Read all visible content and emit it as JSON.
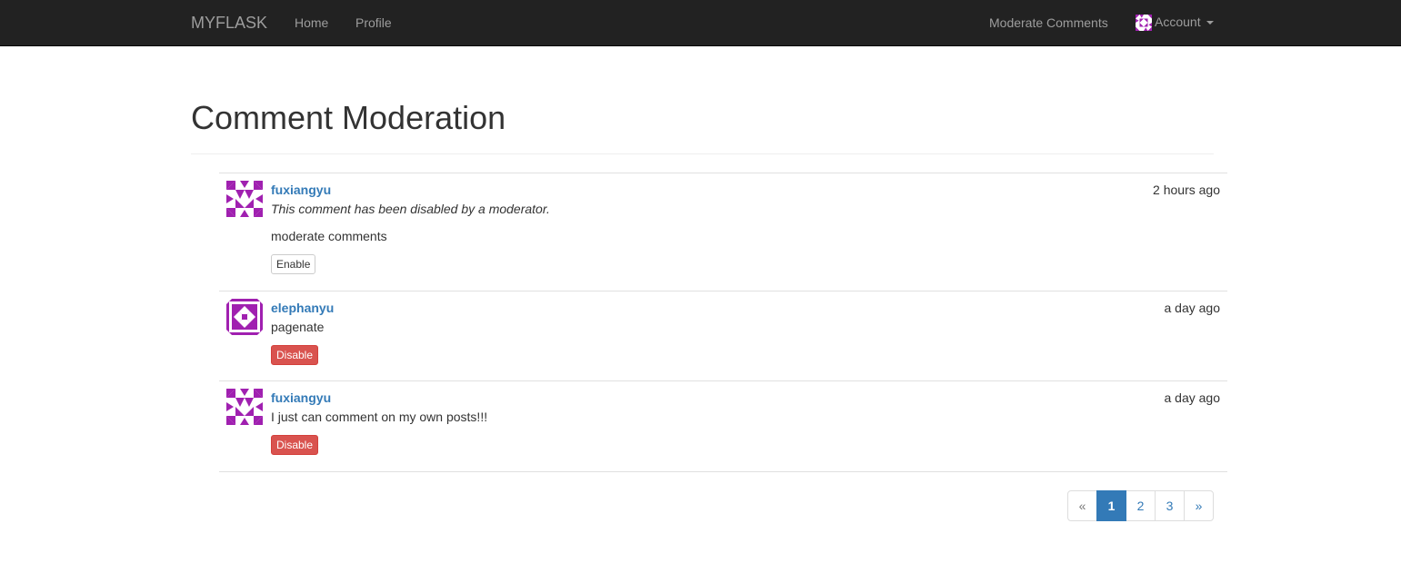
{
  "nav": {
    "brand": "MYFLASK",
    "links": [
      "Home",
      "Profile"
    ],
    "moderate": "Moderate Comments",
    "account": "Account"
  },
  "page": {
    "title": "Comment Moderation"
  },
  "comments": [
    {
      "author": "fuxiangyu",
      "date": "2 hours ago",
      "disabled_note": "This comment has been disabled by a moderator.",
      "body": "moderate comments",
      "action": "Enable"
    },
    {
      "author": "elephanyu",
      "date": "a day ago",
      "body": "pagenate",
      "action": "Disable"
    },
    {
      "author": "fuxiangyu",
      "date": "a day ago",
      "body": "I just can comment on my own posts!!!",
      "action": "Disable"
    }
  ],
  "pagination": {
    "prev": "«",
    "pages": [
      "1",
      "2",
      "3"
    ],
    "next": "»",
    "current": "1"
  },
  "colors": {
    "navbar_bg": "#222222",
    "link": "#337ab7",
    "danger": "#d9534f",
    "avatar": "#a020b0"
  }
}
